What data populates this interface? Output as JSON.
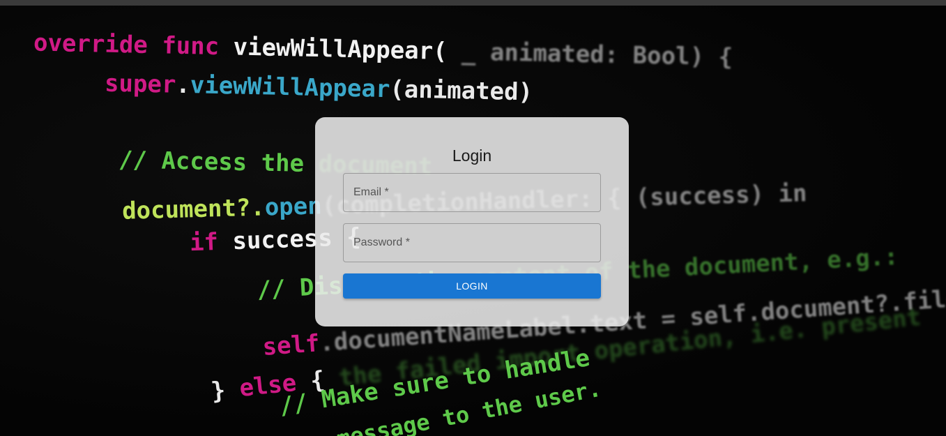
{
  "background_code": {
    "line1": {
      "kw": "override func",
      "fn": "viewWillAppear(",
      "rest": "_ animated: Bool) {"
    },
    "line2": {
      "kw": "super",
      "dot": ".",
      "ty": "viewWillAppear",
      "rest": "(animated)"
    },
    "line3": {
      "cm": "// Access the",
      "cm_dim": "document"
    },
    "line4": {
      "id": "document?.",
      "ty": "open",
      "rest": "(completionHandler: { (success) in"
    },
    "line5": {
      "kw": "if",
      "fn": "success",
      "rest": "{"
    },
    "line6": {
      "cm": "// Display the",
      "cm_dim": "content of the document, e.g.:"
    },
    "line7": {
      "kw": "self",
      "rest": ".documentNameLabel.text = self.document?.fileURL.lastPathComponent"
    },
    "line8": {
      "pl": "}",
      "kw": "else",
      "pl2": "{",
      "cm_dim": "the failed import operation, i.e. present"
    },
    "line9": {
      "cm": "// Make sure to handle"
    },
    "line10": {
      "cm": "message to the user."
    }
  },
  "login_form": {
    "title": "Login",
    "email_label": "Email *",
    "password_label": "Password *",
    "submit_label": "LOGIN"
  },
  "colors": {
    "primary_button": "#1976d2",
    "card_background": "#ebebeb"
  }
}
